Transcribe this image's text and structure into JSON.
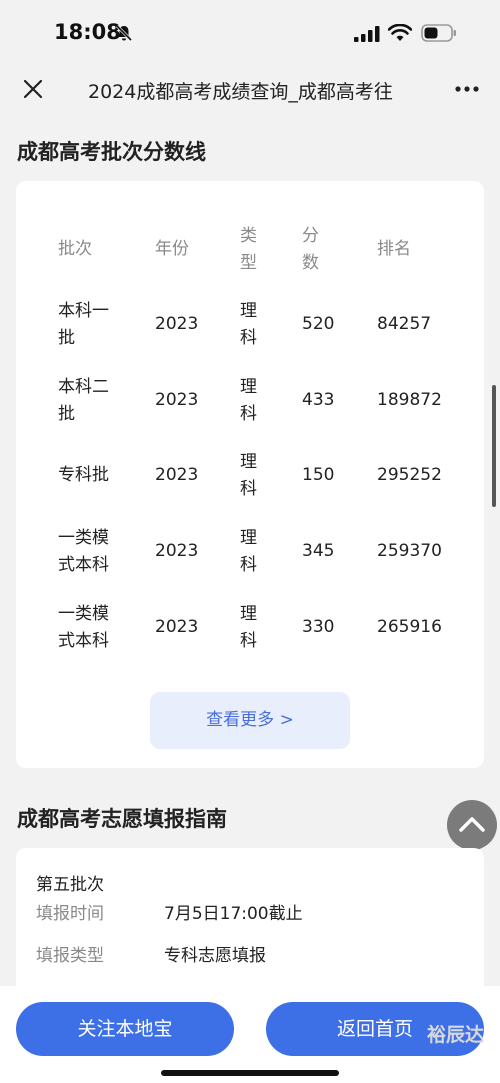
{
  "status_bar": {
    "time": "18:08"
  },
  "nav": {
    "title": "2024成都高考成绩查询_成都高考往"
  },
  "section1": {
    "title": "成都高考批次分数线",
    "headers": [
      "批次",
      "年份",
      "类型",
      "分数",
      "排名"
    ],
    "rows": [
      [
        "本科一批",
        "2023",
        "理科",
        "520",
        "84257"
      ],
      [
        "本科二批",
        "2023",
        "理科",
        "433",
        "189872"
      ],
      [
        "专科批",
        "2023",
        "理科",
        "150",
        "295252"
      ],
      [
        "一类模式本科",
        "2023",
        "理科",
        "345",
        "259370"
      ],
      [
        "一类模式本科",
        "2023",
        "理科",
        "330",
        "265916"
      ]
    ],
    "more_button": "查看更多 >"
  },
  "section2": {
    "title": "成都高考志愿填报指南",
    "batch": "第五批次",
    "fields": [
      {
        "label": "填报时间",
        "value": "7月5日17:00截止"
      },
      {
        "label": "填报类型",
        "value": "专科志愿填报"
      }
    ]
  },
  "bottom": {
    "follow_button": "关注本地宝",
    "home_button": "返回首页",
    "watermark": "裕辰达"
  },
  "colors": {
    "accent": "#3d6fe6",
    "more_bg": "#e8eefc",
    "more_text": "#4a6fd8"
  }
}
